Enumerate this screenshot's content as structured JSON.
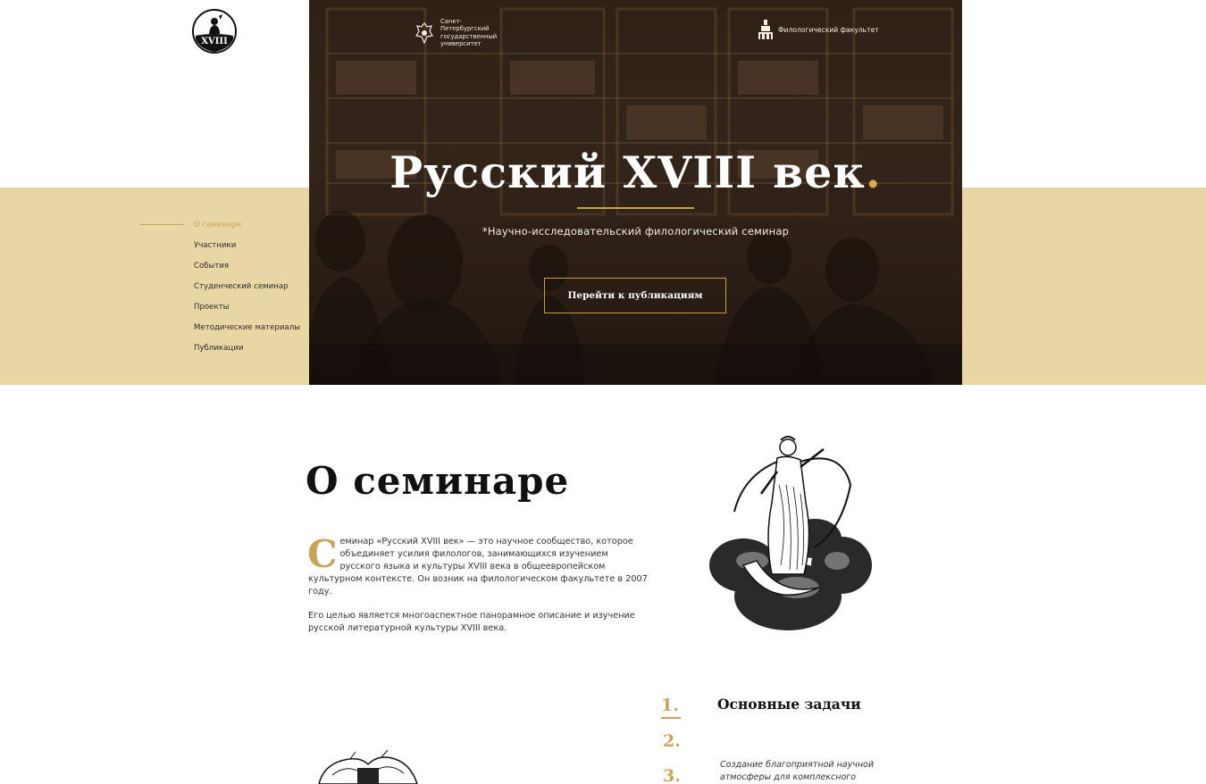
{
  "logo": {
    "text": "XVIII"
  },
  "sidebar": {
    "items": [
      {
        "label": "О семинаре",
        "active": true
      },
      {
        "label": "Участники"
      },
      {
        "label": "События"
      },
      {
        "label": "Студенческий семинар"
      },
      {
        "label": "Проекты"
      },
      {
        "label": "Методические материалы"
      },
      {
        "label": "Публикации"
      }
    ]
  },
  "hero": {
    "university": "Санкт-Петербургский государственный университет",
    "faculty": "Филологический факультет",
    "title": "Русский XVIII век",
    "title_dot": ".",
    "subtitle": "*Научно-исследовательский филологический семинар",
    "button": "Перейти к публикациям"
  },
  "about": {
    "title": "О семинаре",
    "dropcap": "С",
    "p1": "еминар «Русский XVIII век» — это научное сообщество, которое объединяет усилия филологов, занимающихся изучением русского языка и культуры XVIII века в общеевропейском культурном контексте. Он возник на филологическом факультете в 2007 году.",
    "p2": "Его целью является многоаспектное панорамное описание и изучение русской литературной культуры XVIII века."
  },
  "tasks": {
    "title": "Основные задачи",
    "numbers": [
      "1.",
      "2.",
      "3."
    ],
    "item_text": "Создание благоприятной научной атмосферы для комплексного"
  },
  "colors": {
    "accent": "#c8a35a",
    "band": "#e8d6a4"
  }
}
